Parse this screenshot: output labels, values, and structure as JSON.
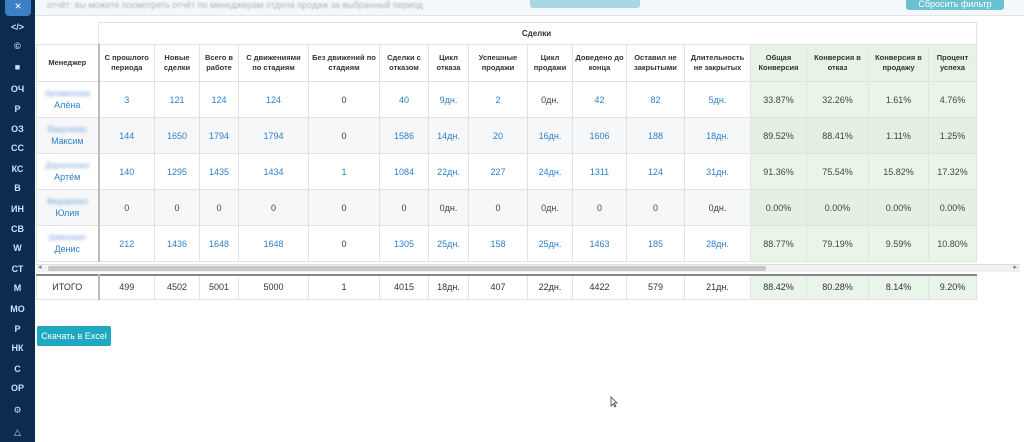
{
  "sidebar": {
    "close_icon": "×",
    "items": [
      "</>",
      "©",
      "■",
      "ОЧ",
      "Р",
      "ОЗ",
      "СС",
      "КС",
      "В",
      "ИН",
      "СВ",
      "W",
      "СТ",
      "М",
      "МО",
      "Р",
      "НК",
      "С",
      "ОР",
      "⚙",
      "△"
    ]
  },
  "topbar": {
    "message": "отчёт: вы можете посмотреть отчёт по менеджерам отдела продаж за выбранный период",
    "reset_label": "Сбросить фильтр"
  },
  "table": {
    "group_header": "Сделки",
    "columns": [
      "Менеджер",
      "С прошлого периода",
      "Новые сделки",
      "Всего в работе",
      "С движениями по стадиям",
      "Без движений по стадиям",
      "Сделки с отказом",
      "Цикл отказа",
      "Успешные продажи",
      "Цикл продажи",
      "Доведено до конца",
      "Оставил не закрытыми",
      "Длительность не закрытых",
      "Общая Конверсия",
      "Конверсия в отказ",
      "Конверсия в продажу",
      "Процент успеха"
    ],
    "rows": [
      {
        "surname": "Артамонова",
        "name": "Алёна",
        "cells": [
          "3",
          "121",
          "124",
          "124",
          "0",
          "40",
          "9дн.",
          "2",
          "0дн.",
          "42",
          "82",
          "5дн.",
          "33.87%",
          "32.26%",
          "1.61%",
          "4.76%"
        ]
      },
      {
        "surname": "Вакуленко",
        "name": "Максим",
        "cells": [
          "144",
          "1650",
          "1794",
          "1794",
          "0",
          "1586",
          "14дн.",
          "20",
          "16дн.",
          "1606",
          "188",
          "18дн.",
          "89.52%",
          "88.41%",
          "1.11%",
          "1.25%"
        ]
      },
      {
        "surname": "Доронченко",
        "name": "Артём",
        "cells": [
          "140",
          "1295",
          "1435",
          "1434",
          "1",
          "1084",
          "22дн.",
          "227",
          "24дн.",
          "1311",
          "124",
          "31дн.",
          "91.36%",
          "75.54%",
          "15.82%",
          "17.32%"
        ]
      },
      {
        "surname": "Федоренко",
        "name": "Юлия",
        "cells": [
          "0",
          "0",
          "0",
          "0",
          "0",
          "0",
          "0дн.",
          "0",
          "0дн.",
          "0",
          "0",
          "0дн.",
          "0.00%",
          "0.00%",
          "0.00%",
          "0.00%"
        ]
      },
      {
        "surname": "Шевченко",
        "name": "Денис",
        "cells": [
          "212",
          "1436",
          "1648",
          "1648",
          "0",
          "1305",
          "25дн.",
          "158",
          "25дн.",
          "1463",
          "185",
          "28дн.",
          "88.77%",
          "79.19%",
          "9.59%",
          "10.80%"
        ]
      }
    ],
    "totals": {
      "label": "ИТОГО",
      "cells": [
        "499",
        "4502",
        "5001",
        "5000",
        "1",
        "4015",
        "18дн.",
        "407",
        "22дн.",
        "4422",
        "579",
        "21дн.",
        "88.42%",
        "80.28%",
        "8.14%",
        "9.20%"
      ]
    }
  },
  "actions": {
    "excel_label": "Скачать в Excel"
  },
  "colors": {
    "sidebar": "#0b2c4f",
    "link": "#2e80c8",
    "green_cell": "#eaf5e9",
    "excel_button": "#1fa9c1"
  }
}
